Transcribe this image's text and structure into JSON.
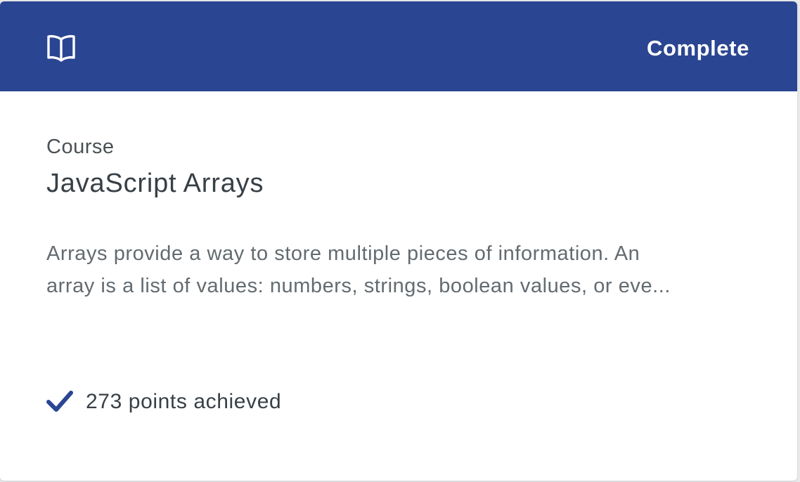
{
  "card": {
    "header": {
      "icon": "book-icon",
      "status": "Complete",
      "color": "#2a4592"
    },
    "type_label": "Course",
    "title": "JavaScript Arrays",
    "description_lines": [
      "Arrays provide a way to store multiple pieces of information. An",
      "array is a list of values: numbers, strings, boolean values, or eve..."
    ],
    "footer": {
      "icon": "check-icon",
      "points_text": "273 points achieved"
    }
  }
}
